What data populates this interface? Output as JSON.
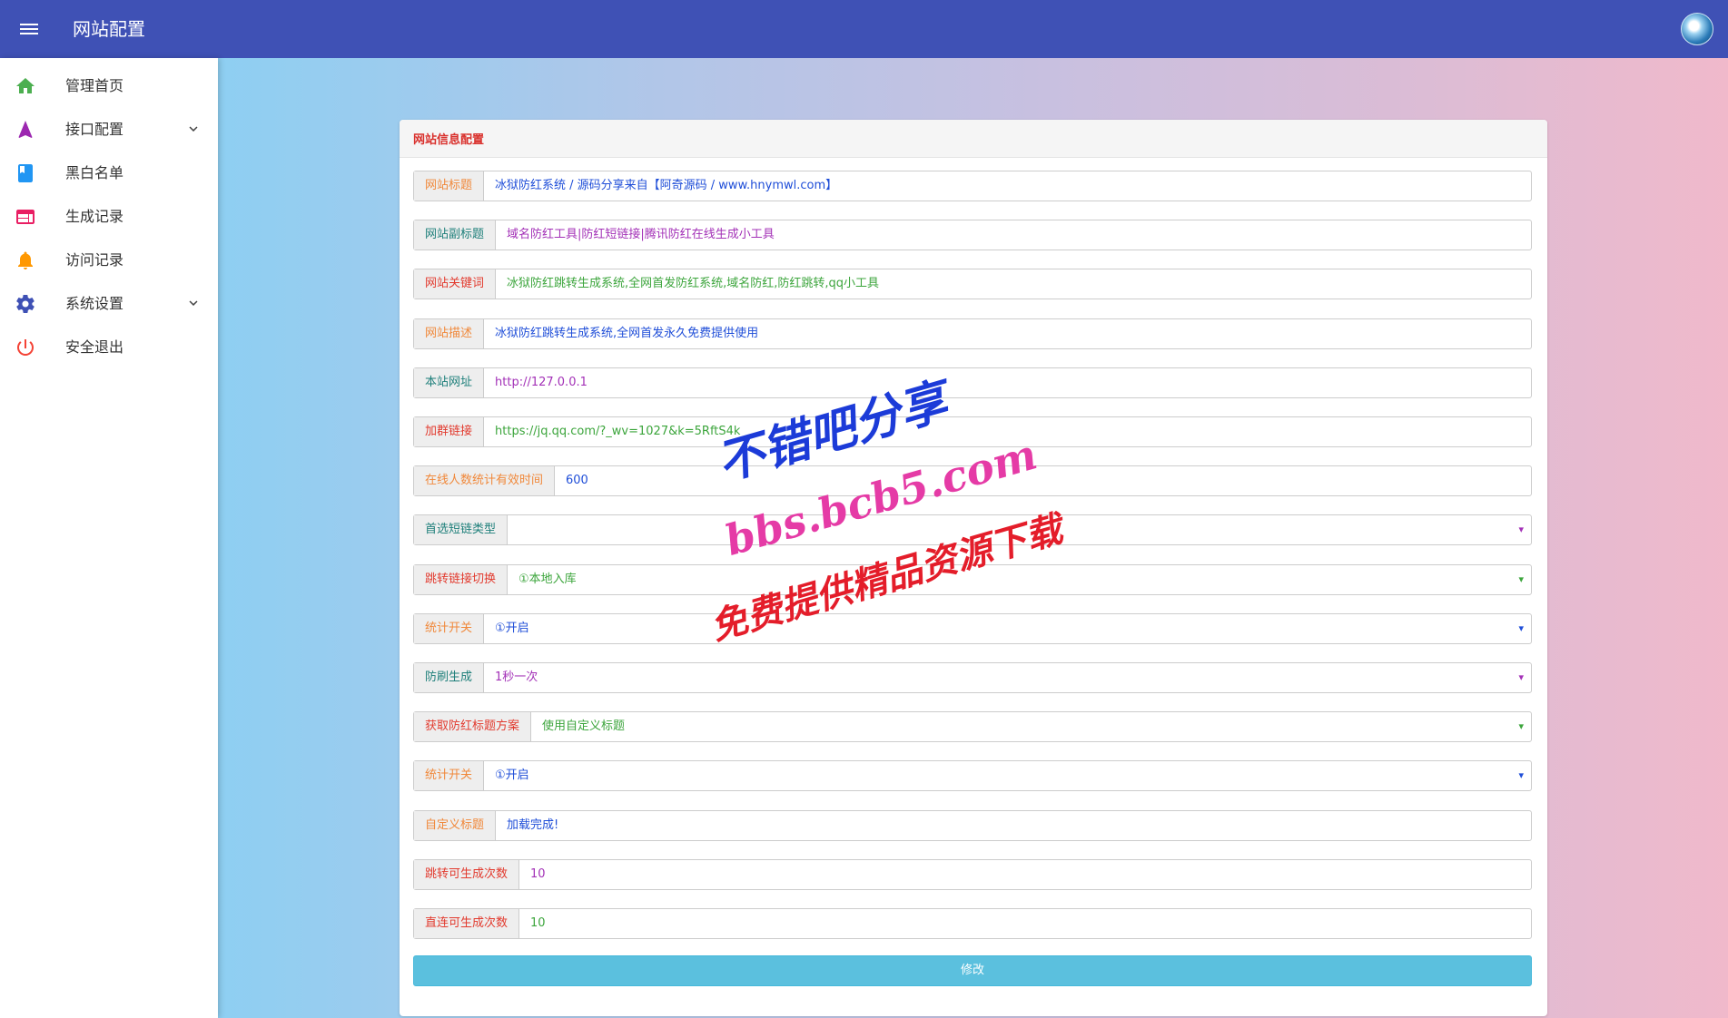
{
  "header": {
    "title": "网站配置",
    "menu_icon": "menu-icon",
    "avatar_icon": "avatar"
  },
  "sidebar": {
    "items": [
      {
        "label": "管理首页",
        "icon": "home-icon",
        "color": "#4caf50",
        "expandable": false
      },
      {
        "label": "接口配置",
        "icon": "navigation-icon",
        "color": "#9c27b0",
        "expandable": true
      },
      {
        "label": "黑白名单",
        "icon": "book-icon",
        "color": "#2196f3",
        "expandable": false
      },
      {
        "label": "生成记录",
        "icon": "web-icon",
        "color": "#e91e63",
        "expandable": false
      },
      {
        "label": "访问记录",
        "icon": "bell-icon",
        "color": "#ff9800",
        "expandable": false
      },
      {
        "label": "系统设置",
        "icon": "gear-icon",
        "color": "#3f51b5",
        "expandable": true
      },
      {
        "label": "安全退出",
        "icon": "power-icon",
        "color": "#f44336",
        "expandable": false
      }
    ]
  },
  "card": {
    "title": "网站信息配置",
    "fields": [
      {
        "label": "网站标题",
        "value": "冰狱防红系统 / 源码分享来自【阿奇源码 / www.hnymwl.com】",
        "label_color": "#f0883a",
        "value_color": "#1f4ed8",
        "type": "text"
      },
      {
        "label": "网站副标题",
        "value": "域名防红工具|防红短链接|腾讯防红在线生成小工具",
        "label_color": "#1e7f7a",
        "value_color": "#a331b7",
        "type": "text"
      },
      {
        "label": "网站关键词",
        "value": "冰狱防红跳转生成系统,全网首发防红系统,域名防红,防红跳转,qq小工具",
        "label_color": "#e23a2e",
        "value_color": "#3ca53c",
        "type": "text"
      },
      {
        "label": "网站描述",
        "value": "冰狱防红跳转生成系统,全网首发永久免费提供使用",
        "label_color": "#f0883a",
        "value_color": "#1f4ed8",
        "type": "text"
      },
      {
        "label": "本站网址",
        "value": "http://127.0.0.1",
        "label_color": "#1e7f7a",
        "value_color": "#a331b7",
        "type": "text"
      },
      {
        "label": "加群链接",
        "value": "https://jq.qq.com/?_wv=1027&k=5RftS4k",
        "label_color": "#e23a2e",
        "value_color": "#3ca53c",
        "type": "text"
      },
      {
        "label": "在线人数统计有效时间",
        "value": "600",
        "label_color": "#f0883a",
        "value_color": "#1f4ed8",
        "type": "text"
      },
      {
        "label": "首选短链类型",
        "value": "",
        "label_color": "#1e7f7a",
        "value_color": "#a331b7",
        "type": "select"
      },
      {
        "label": "跳转链接切换",
        "value": "①本地入库",
        "label_color": "#e23a2e",
        "value_color": "#3ca53c",
        "type": "select"
      },
      {
        "label": "统计开关",
        "value": "①开启",
        "label_color": "#f0883a",
        "value_color": "#1f4ed8",
        "type": "select"
      },
      {
        "label": "防刷生成",
        "value": "1秒一次",
        "label_color": "#1e7f7a",
        "value_color": "#a331b7",
        "type": "select"
      },
      {
        "label": "获取防红标题方案",
        "value": "使用自定义标题",
        "label_color": "#e23a2e",
        "value_color": "#3ca53c",
        "type": "select"
      },
      {
        "label": "统计开关",
        "value": "①开启",
        "label_color": "#f0883a",
        "value_color": "#1f4ed8",
        "type": "select"
      },
      {
        "label": "自定义标题",
        "value": "加载完成!",
        "label_color": "#f0883a",
        "value_color": "#1f4ed8",
        "type": "text"
      },
      {
        "label": "跳转可生成次数",
        "value": "10",
        "label_color": "#e23a2e",
        "value_color": "#a331b7",
        "type": "text"
      },
      {
        "label": "直连可生成次数",
        "value": "10",
        "label_color": "#e23a2e",
        "value_color": "#3ca53c",
        "type": "text"
      }
    ],
    "submit_label": "修改"
  },
  "watermark": {
    "line1": "不错吧分享",
    "line2": "bbs.bcb5.com",
    "line3": "免费提供精品资源下载"
  },
  "colors": {
    "topbar": "#3f51b5",
    "submit": "#5bc0de",
    "card_title": "#d9302c"
  }
}
